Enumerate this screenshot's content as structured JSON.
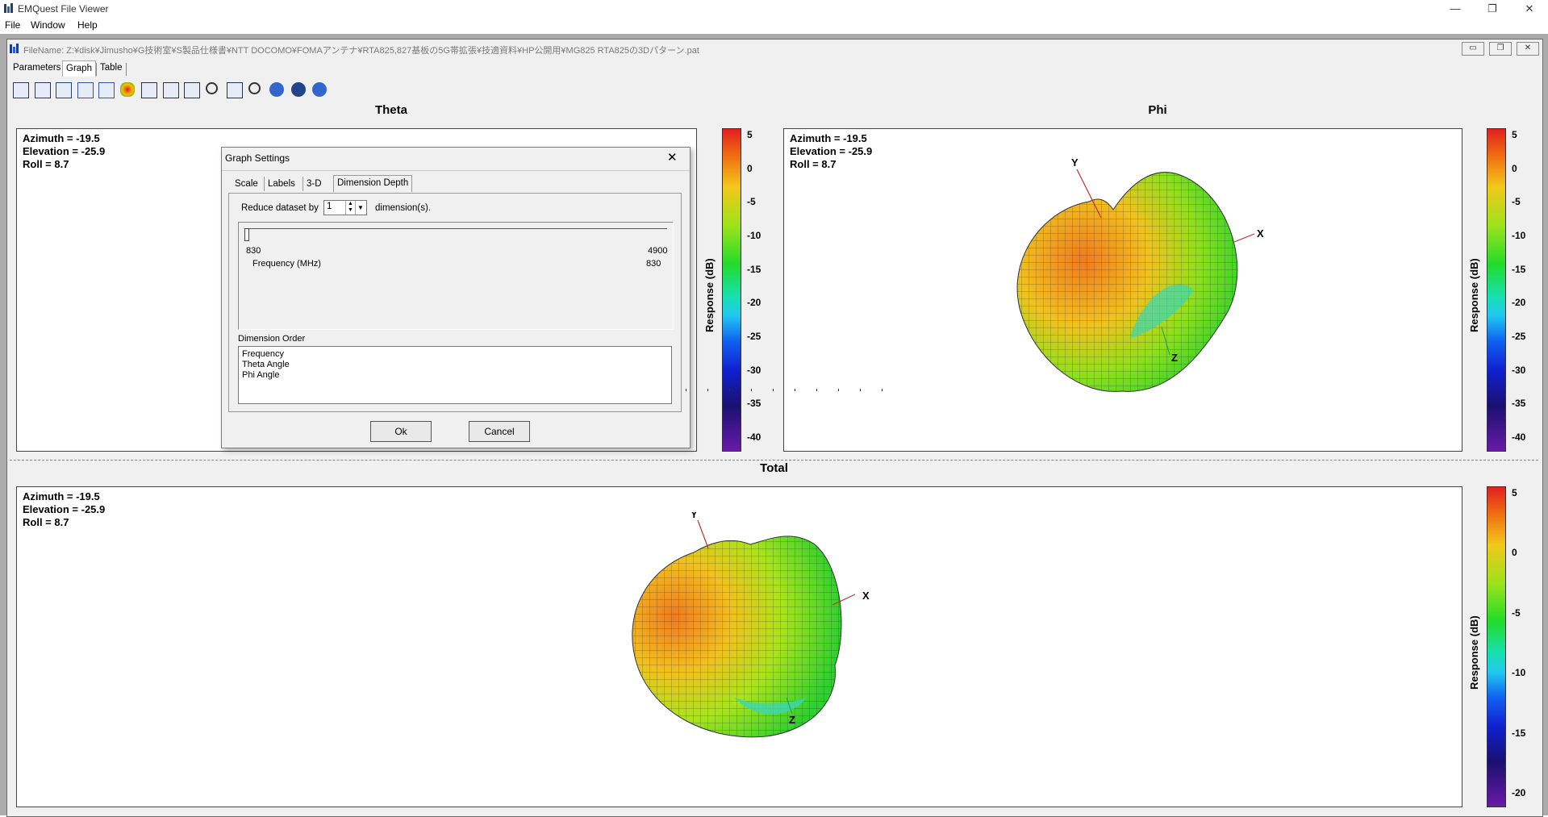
{
  "window": {
    "title": "EMQuest File Viewer",
    "controls": {
      "minimize": "—",
      "restore": "❐",
      "close": "✕"
    }
  },
  "menu": [
    "File",
    "Window",
    "Help"
  ],
  "child": {
    "filename_label": "FileName: Z:¥disk¥Jimusho¥G技術室¥S製品仕様書¥NTT DOCOMO¥FOMAアンテナ¥RTA825,827基板の5G帯拡張¥技適資料¥HP公開用¥MG825 RTA825の3Dパターン.pat",
    "controls": {
      "minimize": "▭",
      "restore": "❐",
      "close": "✕"
    }
  },
  "tabs": [
    {
      "label": "Parameters",
      "active": false
    },
    {
      "label": "Graph",
      "active": true
    },
    {
      "label": "Table",
      "active": false
    }
  ],
  "toolbar_icons": [
    "table-icon",
    "table-alt-icon",
    "graph-icon",
    "polar-icon",
    "export-icon",
    "surface-icon",
    "linear-graph-icon",
    "overlay-graph-icon",
    "multi-graph-icon",
    "zoom-icon",
    "settings-icon",
    "zoom-out-icon",
    "sphere-half-icon",
    "sphere-icon",
    "sphere-cut-icon"
  ],
  "panels": {
    "theta": {
      "title": "Theta",
      "azimuth": "Azimuth = -19.5",
      "elevation": "Elevation = -25.9",
      "roll": "Roll = 8.7",
      "colorbar_label": "Response  (dB)",
      "ticks": [
        "5",
        "0",
        "-5",
        "-10",
        "-15",
        "-20",
        "-25",
        "-30",
        "-35",
        "-40"
      ]
    },
    "phi": {
      "title": "Phi",
      "azimuth": "Azimuth = -19.5",
      "elevation": "Elevation = -25.9",
      "roll": "Roll = 8.7",
      "colorbar_label": "Response  (dB)",
      "ticks": [
        "5",
        "0",
        "-5",
        "-10",
        "-15",
        "-20",
        "-25",
        "-30",
        "-35",
        "-40"
      ],
      "axes": {
        "x": "X",
        "y": "Y",
        "z": "Z"
      }
    },
    "total": {
      "title": "Total",
      "azimuth": "Azimuth = -19.5",
      "elevation": "Elevation = -25.9",
      "roll": "Roll = 8.7",
      "colorbar_label": "Response  (dB)",
      "ticks": [
        "5",
        "0",
        "-5",
        "-10",
        "-15",
        "-20"
      ],
      "axes": {
        "x": "X",
        "y": "Y",
        "z": "Z"
      }
    }
  },
  "dialog": {
    "title": "Graph Settings",
    "close": "✕",
    "tabs": [
      {
        "label": "Scale",
        "active": false
      },
      {
        "label": "Labels",
        "active": false
      },
      {
        "label": "3-D",
        "active": false
      },
      {
        "label": "Dimension Depth",
        "active": true
      }
    ],
    "reduce_label": "Reduce dataset by",
    "reduce_value": "1",
    "reduce_unit": "dimension(s).",
    "slider": {
      "min": "830",
      "max": "4900",
      "name": "Frequency  (MHz)",
      "current": "830"
    },
    "order_label": "Dimension Order",
    "order_items": [
      "Frequency",
      "Theta Angle",
      "Phi Angle"
    ],
    "ok": "Ok",
    "cancel": "Cancel"
  }
}
